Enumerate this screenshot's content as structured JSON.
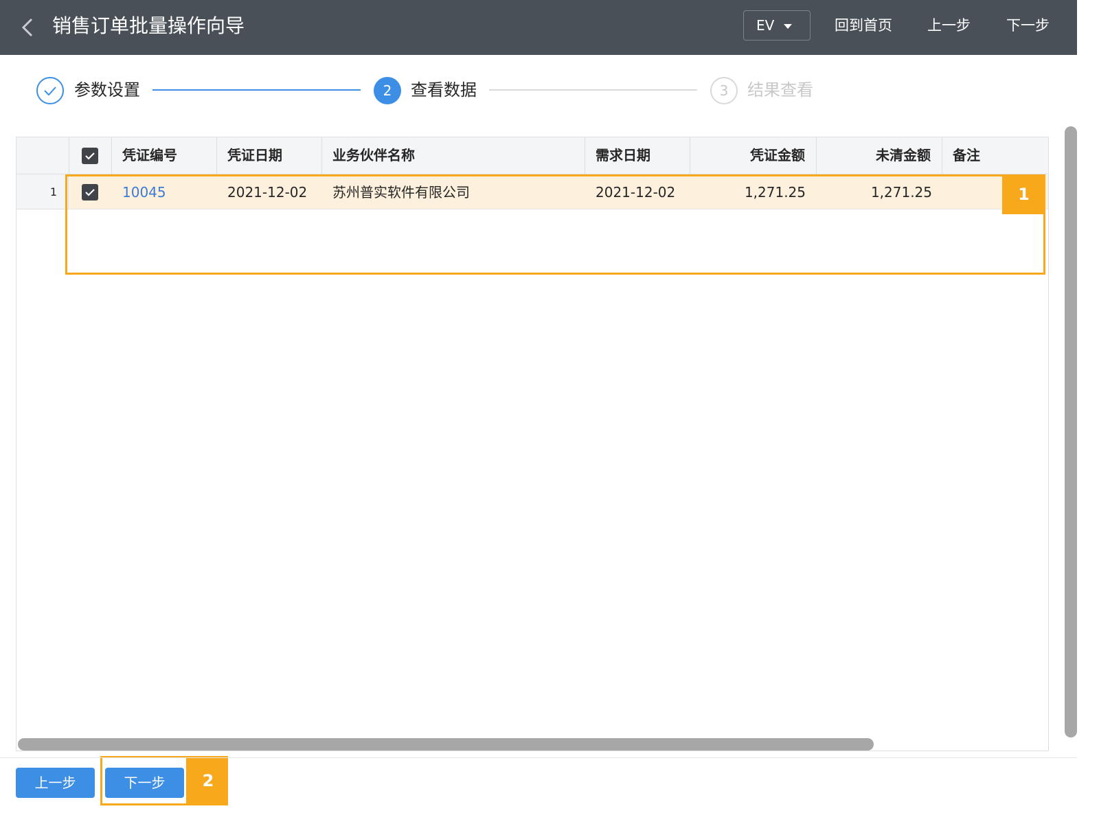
{
  "header": {
    "title": "销售订单批量操作向导",
    "select_value": "EV",
    "home_label": "回到首页",
    "prev_label": "上一步",
    "next_label": "下一步"
  },
  "steps": [
    {
      "label": "参数设置",
      "state": "done",
      "icon": "check-icon"
    },
    {
      "label": "查看数据",
      "state": "active",
      "number": "2"
    },
    {
      "label": "结果查看",
      "state": "pending",
      "number": "3"
    }
  ],
  "table": {
    "columns": [
      "凭证编号",
      "凭证日期",
      "业务伙伴名称",
      "需求日期",
      "凭证金额",
      "未清金额",
      "备注"
    ],
    "rows": [
      {
        "index": "1",
        "checked": true,
        "doc_no": "10045",
        "doc_date": "2021-12-02",
        "partner": "苏州普实软件有限公司",
        "due_date": "2021-12-02",
        "amount": "1,271.25",
        "open_amount": "1,271.25",
        "remark": ""
      }
    ]
  },
  "annotations": {
    "badge1": "1",
    "badge2": "2"
  },
  "footer": {
    "prev_label": "上一步",
    "next_label": "下一步"
  },
  "colors": {
    "header_bg": "#4a5058",
    "accent": "#3d8fe6",
    "highlight": "#f7a81b",
    "selected_row": "#fdf0dc"
  }
}
